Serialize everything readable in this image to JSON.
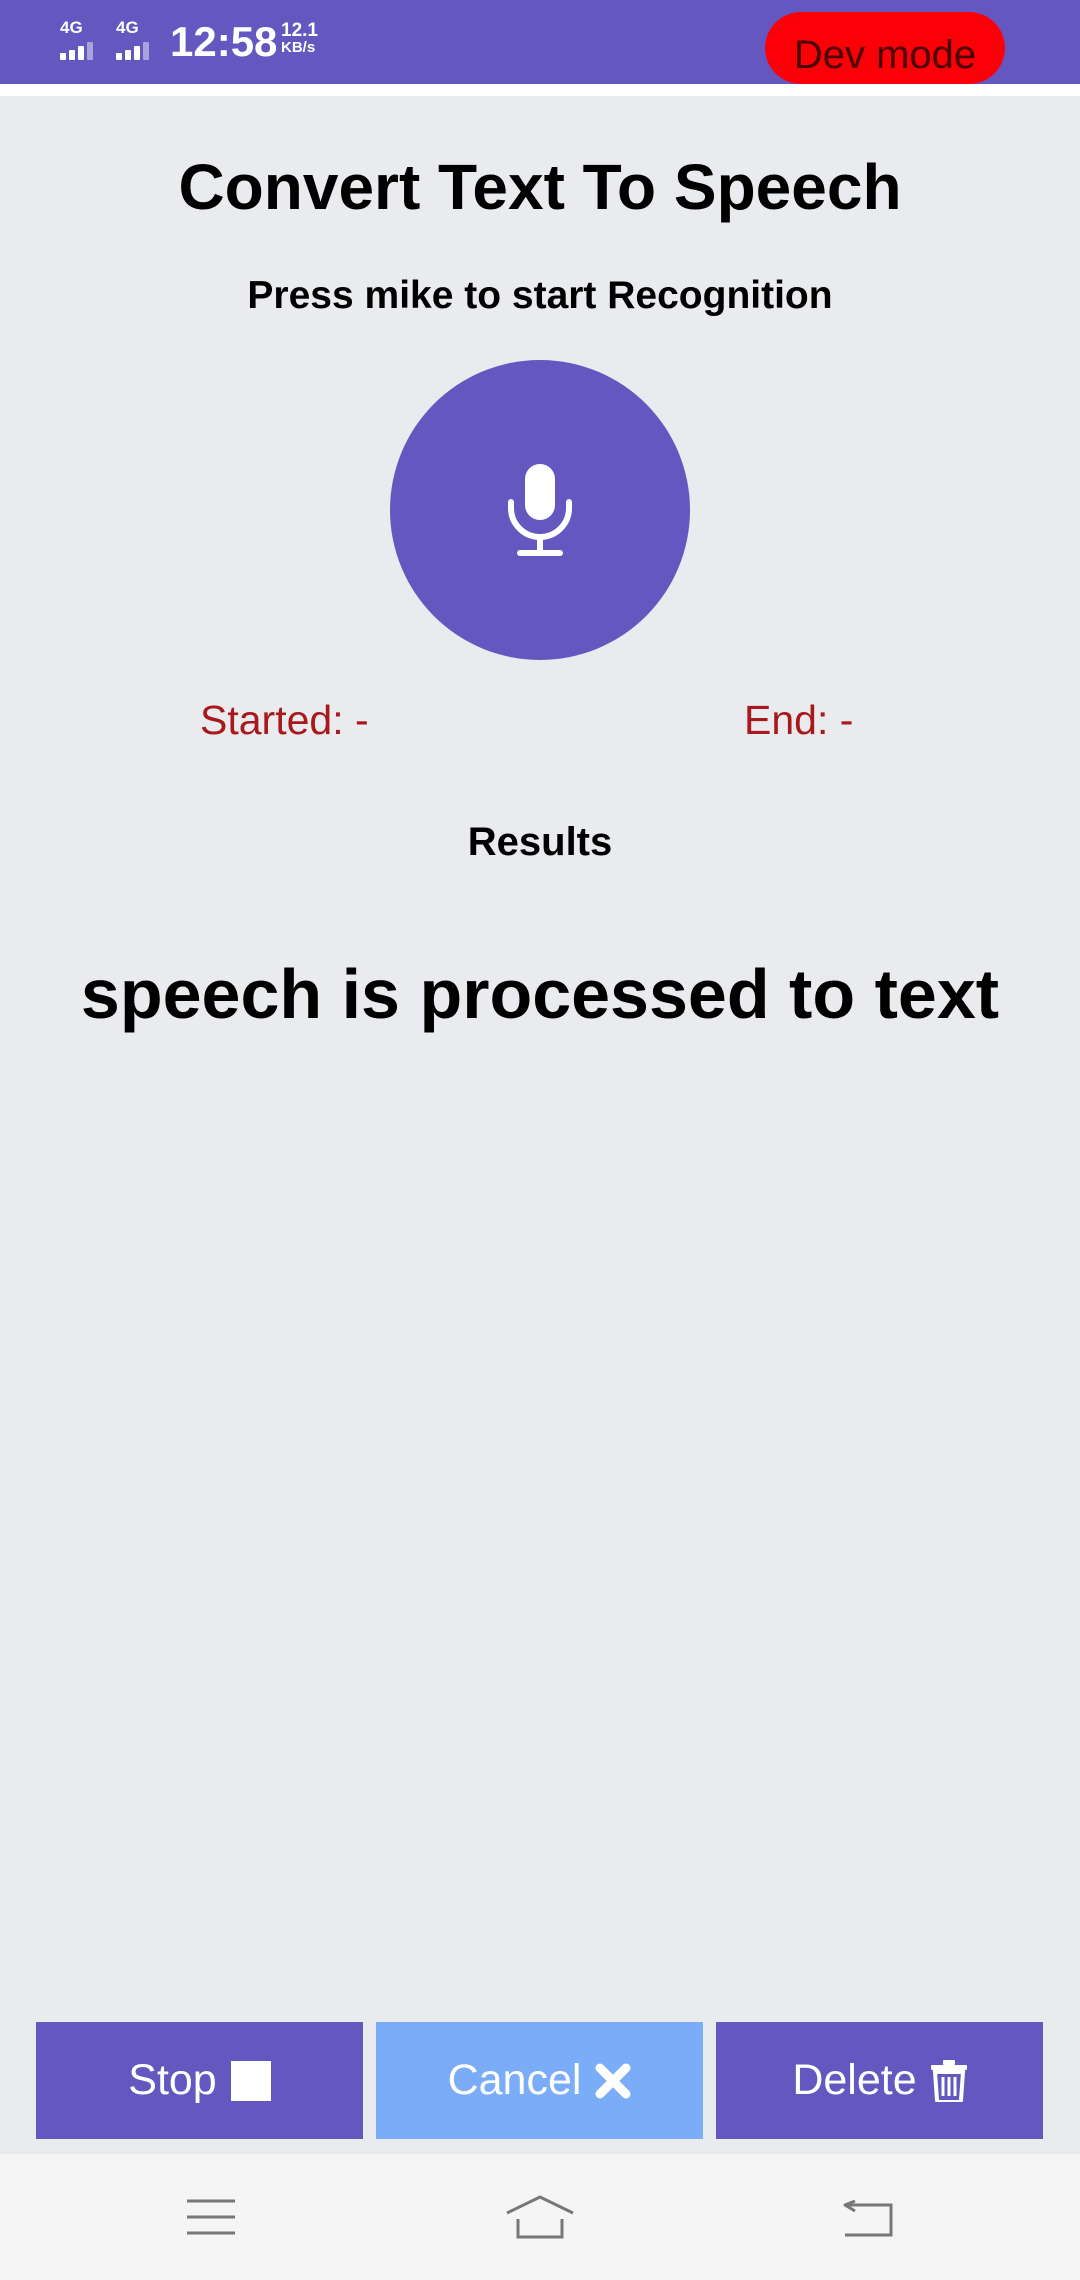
{
  "status_bar": {
    "network_1": "4G",
    "network_2": "4G",
    "time": "12:58",
    "speed_value": "12.1",
    "speed_unit": "KB/s",
    "background_color": "#6557c0"
  },
  "dev_mode": {
    "label": "Dev mode",
    "color": "#fb0007"
  },
  "main": {
    "title": "Convert Text To Speech",
    "subtitle": "Press mike to start Recognition",
    "mic_icon": "microphone-icon",
    "started_label": "Started: -",
    "end_label": "End: -",
    "results_heading": "Results",
    "result_text": "speech is processed to text"
  },
  "buttons": {
    "stop": {
      "label": "Stop",
      "icon": "stop-square-icon"
    },
    "cancel": {
      "label": "Cancel",
      "icon": "close-x-icon"
    },
    "delete": {
      "label": "Delete",
      "icon": "trash-icon"
    }
  },
  "colors": {
    "primary": "#6557c0",
    "cancel": "#7aacf7",
    "status_text": "#a8191c",
    "background": "#eaebef"
  },
  "nav_bar": {
    "icons": [
      "menu-icon",
      "home-icon",
      "back-icon"
    ]
  }
}
